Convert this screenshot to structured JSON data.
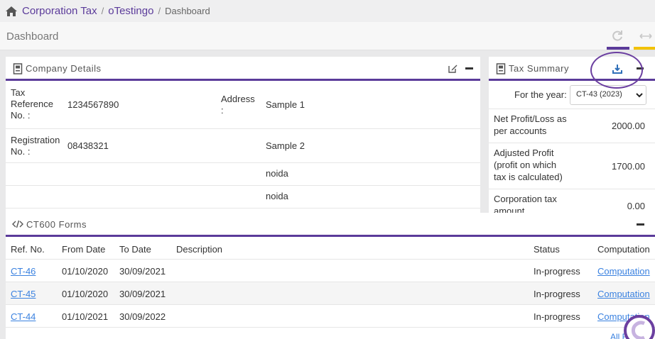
{
  "breadcrumb": {
    "home_icon": "home-icon",
    "items": [
      "Corporation Tax",
      "oTestingo"
    ],
    "current": "Dashboard"
  },
  "page": {
    "title": "Dashboard",
    "accent": "#5b3b9a",
    "yellow": "#f2c200"
  },
  "company_details": {
    "title": "Company Details",
    "tax_ref_label_1": "Tax",
    "tax_ref_label_2": "Reference",
    "tax_ref_label_3": "No. :",
    "tax_ref_value": "1234567890",
    "address_label_1": "Address",
    "address_label_2": ":",
    "address_lines": [
      "Sample 1",
      "Sample 2",
      "noida",
      "noida"
    ],
    "reg_label_1": "Registration",
    "reg_label_2": "No. :",
    "reg_value": "08438321"
  },
  "tax_summary": {
    "title": "Tax Summary",
    "year_label": "For the year:",
    "year_value": "CT-43 (2023)",
    "rows": [
      {
        "label_1": "Net Profit/Loss as",
        "label_2": "per accounts",
        "value": "2000.00"
      },
      {
        "label_1": "Adjusted Profit",
        "label_2": "(profit on which",
        "label_3": "tax is calculated)",
        "value": "1700.00"
      },
      {
        "label_1": "Corporation tax",
        "label_2": "amount",
        "value": "0.00"
      }
    ]
  },
  "forms": {
    "title": "CT600 Forms",
    "headers": {
      "ref": "Ref. No.",
      "from": "From Date",
      "to": "To Date",
      "desc": "Description",
      "status": "Status",
      "comp": "Computation"
    },
    "rows": [
      {
        "ref": "CT-46",
        "from": "01/10/2020",
        "to": "30/09/2021",
        "status": "In-progress",
        "comp": "Computation"
      },
      {
        "ref": "CT-45",
        "from": "01/10/2020",
        "to": "30/09/2021",
        "status": "In-progress",
        "comp": "Computation"
      },
      {
        "ref": "CT-44",
        "from": "01/10/2021",
        "to": "30/09/2022",
        "status": "In-progress",
        "comp": "Computation"
      }
    ],
    "all_forms": "All Forms"
  }
}
